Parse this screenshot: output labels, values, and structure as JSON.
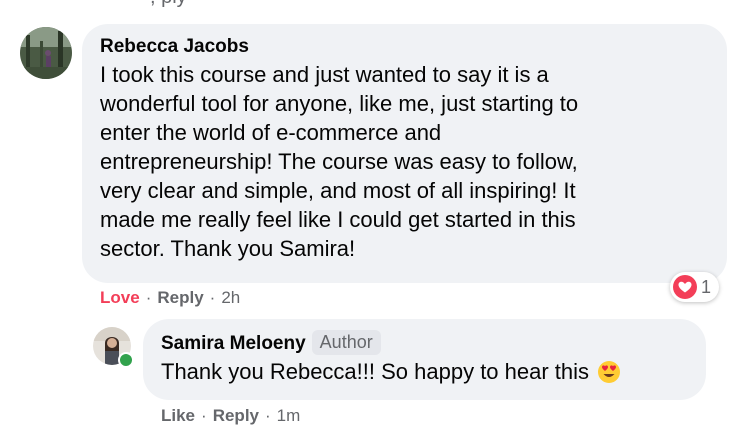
{
  "cut_text": ", ply",
  "comment": {
    "author": "Rebecca Jacobs",
    "text_lines": [
      "I took this course and just wanted to say it is a",
      "wonderful tool for anyone, like me, just starting to",
      "enter the world of e-commerce and",
      "entrepreneurship! The course was easy to follow,",
      "very clear and simple, and most of all inspiring! It",
      "made me really feel like I could get started in this",
      "sector. Thank you Samira!"
    ],
    "actions": {
      "love": "Love",
      "reply": "Reply",
      "time": "2h"
    },
    "reaction": {
      "icon": "love-heart-icon",
      "count": "1",
      "color": "#f33e58"
    }
  },
  "reply": {
    "author": "Samira Meloeny",
    "badge": "Author",
    "text": "Thank you Rebecca!!! So happy to hear this",
    "emoji": "heart-eyes-emoji",
    "actions": {
      "like": "Like",
      "reply": "Reply",
      "time": "1m"
    },
    "online": true
  }
}
